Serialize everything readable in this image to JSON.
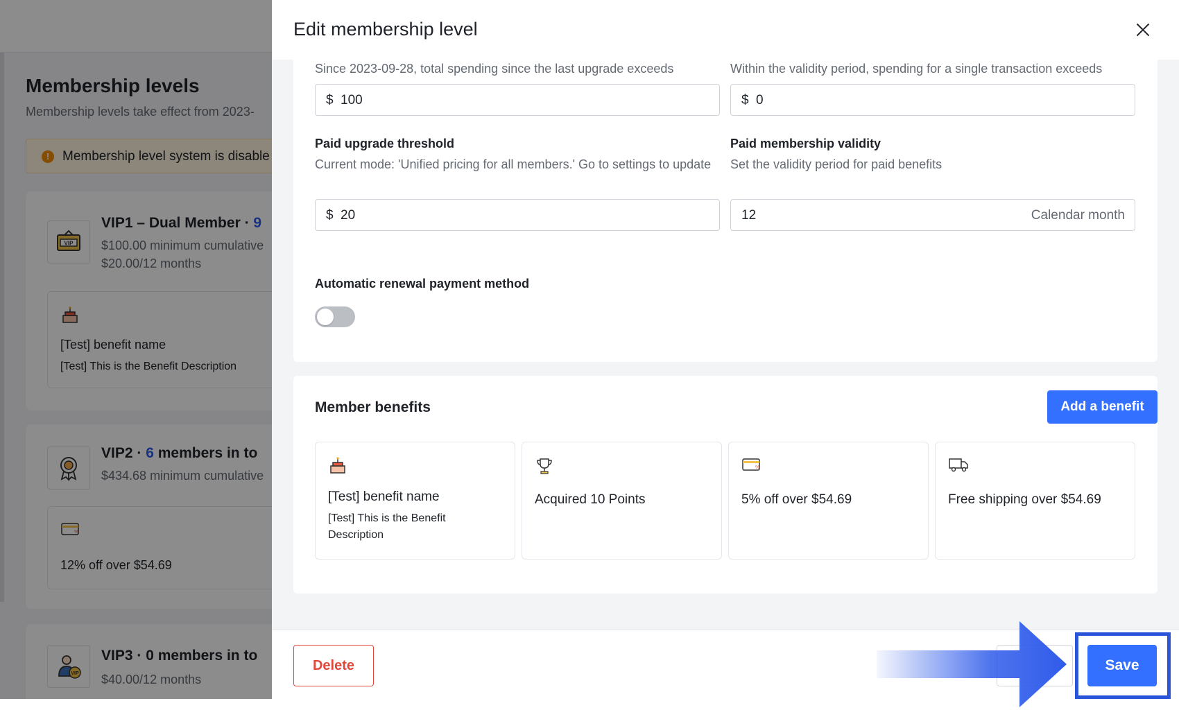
{
  "background": {
    "page_title": "Membership levels",
    "page_subtitle": "Membership levels take effect from 2023-",
    "alert_text": "Membership level system is disable",
    "levels": [
      {
        "name": "VIP1 – Dual Member ·",
        "count": "9",
        "line1": "$100.00 minimum cumulative",
        "line2": "$20.00/12 months",
        "benefit_name": "[Test] benefit name",
        "benefit_desc": "[Test] This is the Benefit Description"
      },
      {
        "name": "VIP2 ·",
        "count": "6",
        "suffix": "members in to",
        "line1": "$434.68 minimum cumulative",
        "benefit_name": "12% off over $54.69"
      },
      {
        "name": "VIP3 ·",
        "count": "0",
        "suffix": "members in to",
        "line1": "$40.00/12 months"
      }
    ]
  },
  "drawer": {
    "title": "Edit membership level",
    "spend_since_help": "Since 2023-09-28, total spending since the last upgrade exceeds",
    "spend_since_prefix": "$",
    "spend_since_value": "100",
    "single_txn_help": "Within the validity period, spending for a single transaction exceeds",
    "single_txn_prefix": "$",
    "single_txn_value": "0",
    "paid_threshold_label": "Paid upgrade threshold",
    "paid_threshold_help": "Current mode: 'Unified pricing for all members.' Go to settings to update",
    "paid_threshold_prefix": "$",
    "paid_threshold_value": "20",
    "validity_label": "Paid membership validity",
    "validity_help": "Set the validity period for paid benefits",
    "validity_value": "12",
    "validity_unit": "Calendar month",
    "auto_renew_label": "Automatic renewal payment method",
    "auto_renew_enabled": false,
    "benefits_title": "Member benefits",
    "add_benefit_label": "Add a benefit",
    "benefits": [
      {
        "icon": "cake-icon",
        "name": "[Test] benefit name",
        "desc": "[Test] This is the Benefit Description"
      },
      {
        "icon": "trophy-icon",
        "name": "Acquired 10 Points"
      },
      {
        "icon": "discount-card-icon",
        "name": "5% off over $54.69"
      },
      {
        "icon": "truck-icon",
        "name": "Free shipping over $54.69"
      }
    ],
    "delete_label": "Delete",
    "cancel_label": "",
    "save_label": "Save"
  },
  "colors": {
    "primary": "#3370ff",
    "danger": "#e0483a",
    "count_accent": "#2e5be8",
    "highlight": "#2a55d8"
  }
}
